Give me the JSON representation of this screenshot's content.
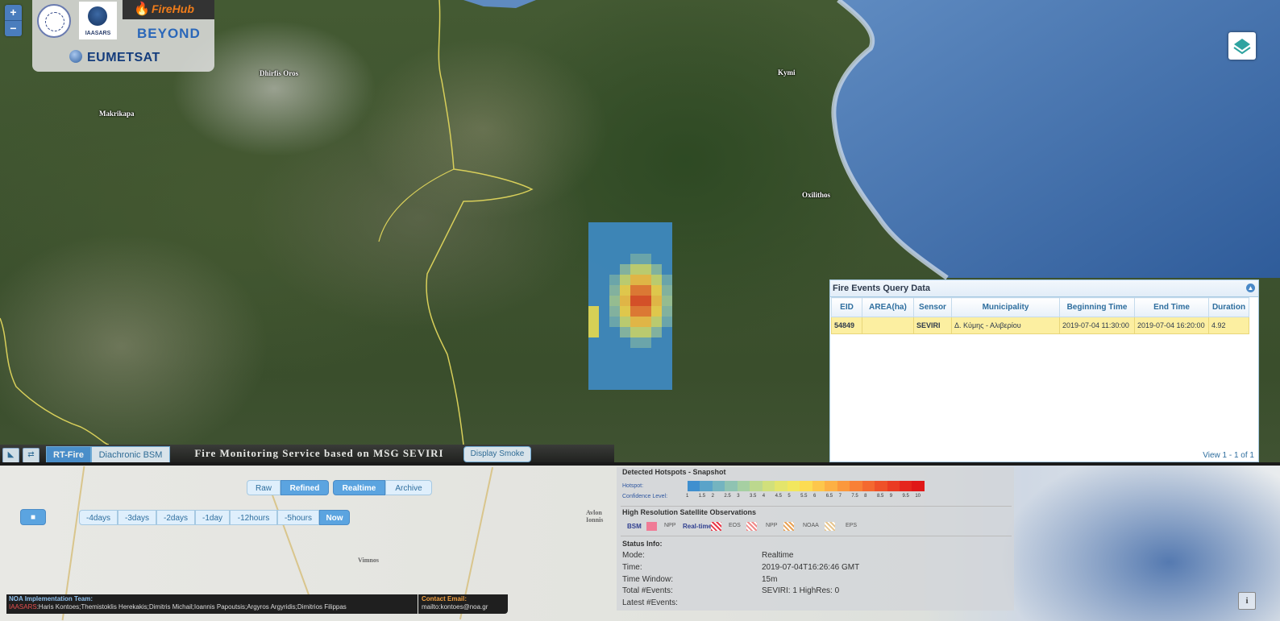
{
  "zoom": {
    "in": "+",
    "out": "−"
  },
  "logos": {
    "iaasars": "IAASARS",
    "firehub": "FireHub",
    "beyond": "BEYOND",
    "eumetsat": "EUMETSAT"
  },
  "places": [
    "Dhirfis Oros",
    "Makrikapa",
    "Kymi",
    "Oxilithos",
    "Avlon\nIonnis",
    "Vimnos"
  ],
  "events_panel": {
    "title": "Fire Events Query Data",
    "columns": [
      "EID",
      "AREA(ha)",
      "Sensor",
      "Municipality",
      "Beginning Time",
      "End Time",
      "Duration"
    ],
    "rows": [
      [
        "54849",
        "",
        "SEVIRI",
        "Δ. Κύμης - Αλιβερίου",
        "2019-07-04 11:30:00",
        "2019-07-04 16:20:00",
        "4.92"
      ]
    ],
    "pager": "View 1 - 1 of 1"
  },
  "control_bar": {
    "tabs": [
      "RT-Fire",
      "Diachronic BSM"
    ],
    "service_title": "Fire Monitoring Service based on MSG SEVIRI",
    "smoke_button": "Display Smoke"
  },
  "modes": [
    "Raw",
    "Refined",
    "Realtime",
    "Archive"
  ],
  "play_button": "■",
  "time_buttons": [
    "-4days",
    "-3days",
    "-2days",
    "-1day",
    "-12hours",
    "-5hours",
    "Now"
  ],
  "hotspots": {
    "title": "Detected Hotspots - Snapshot",
    "hotspot_label": "Hotspot:",
    "confidence_label": "Confidence Level:",
    "confidence_levels": [
      "1",
      "1.5",
      "2",
      "2.5",
      "3",
      "3.5",
      "4",
      "4.5",
      "5",
      "5.5",
      "6",
      "6.5",
      "7",
      "7.5",
      "8",
      "8.5",
      "9",
      "9.5",
      "10"
    ],
    "scale_colors": [
      "#3f8fcf",
      "#5aa3c9",
      "#74b4c0",
      "#8fc3b2",
      "#a6cfa2",
      "#bcd88e",
      "#d1e07b",
      "#e4e56b",
      "#f2e75e",
      "#fcdc52",
      "#fdc74b",
      "#fdb044",
      "#fb983d",
      "#f88036",
      "#f4692f",
      "#ef5128",
      "#ea3b22",
      "#e5261d",
      "#e01818"
    ],
    "hires_title": "High Resolution Satellite Observations",
    "bsm": "BSM",
    "npp1": "NPP",
    "realtime": "Real-time",
    "eos": "EOS",
    "npp2": "NPP",
    "noaa": "NOAA",
    "eps": "EPS"
  },
  "status": {
    "title": "Status Info:",
    "mode_label": "Mode:",
    "mode_value": "Realtime",
    "time_label": "Time:",
    "time_value": "2019-07-04T16:26:46 GMT",
    "window_label": "Time Window:",
    "window_value": "15m",
    "total_label": "Total #Events:",
    "total_value": "SEVIRI: 1  HighRes: 0",
    "latest_label": "Latest #Events:"
  },
  "team": {
    "title": "NOA Implementation Team:",
    "org": "IAASARS",
    "members": ":Haris Kontoes;Themistoklis Herekakis;Dimitris Michail;Ioannis Papoutsis;Argyros Argyridis;Dimitrios Filippas"
  },
  "contact": {
    "title": "Contact Email:",
    "email": "mailto:kontoes@noa.gr"
  },
  "info_button": "i",
  "colors": {
    "accent": "#4a93d6",
    "highlight_row": "#fcefa1",
    "control_bar": "#2a2a2a"
  }
}
